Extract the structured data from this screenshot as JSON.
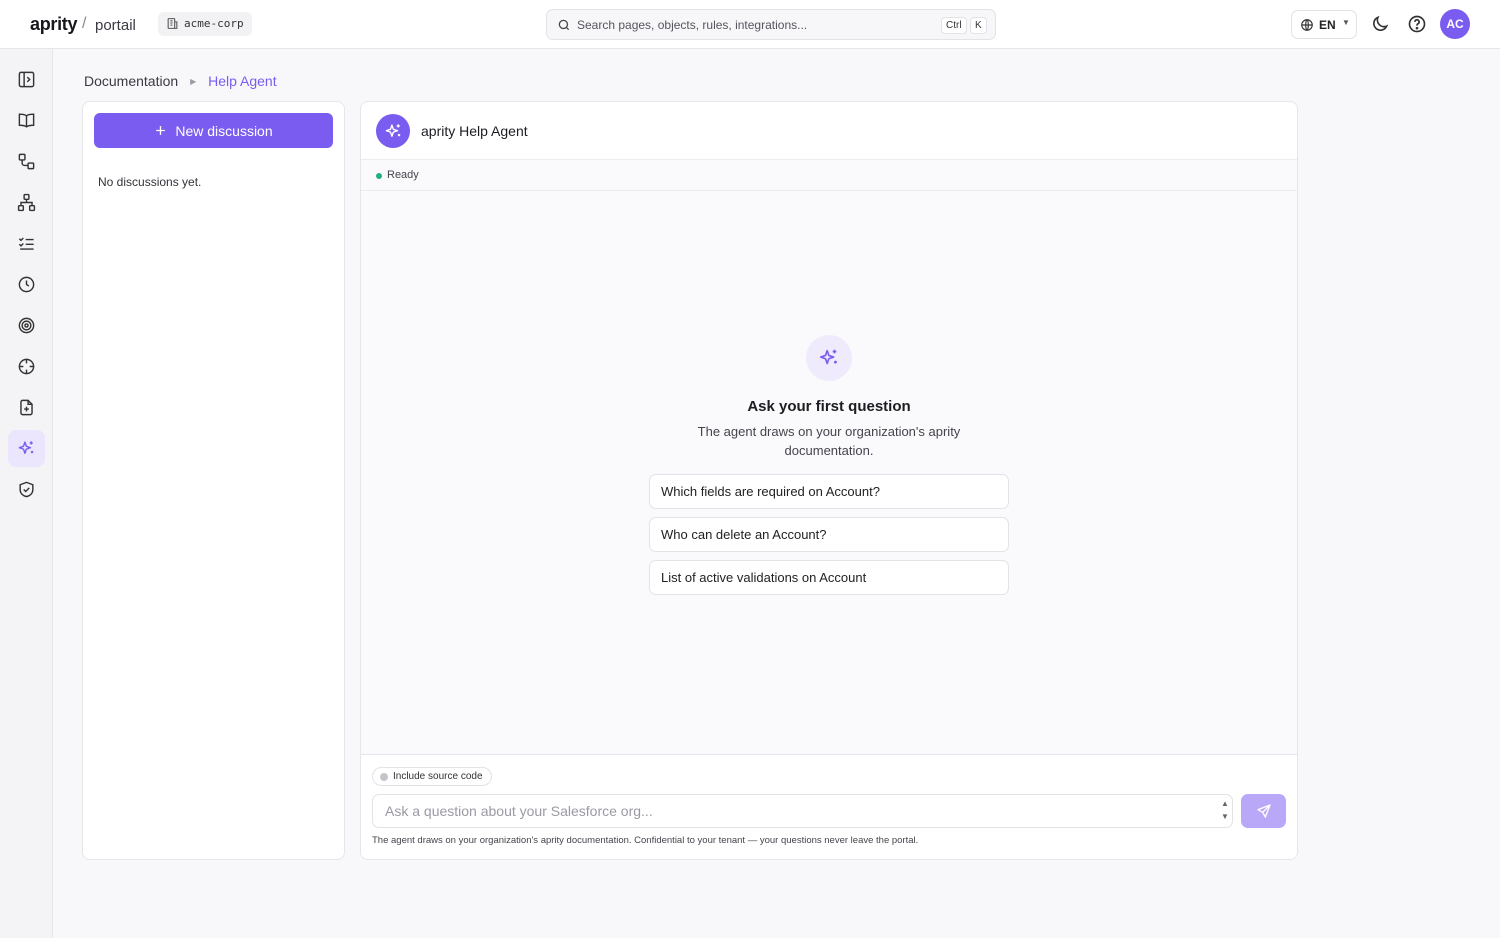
{
  "header": {
    "brand": "aprity",
    "separator": "/",
    "product": "portail",
    "tenant": "acme-corp",
    "search_placeholder": "Search pages, objects, rules, integrations...",
    "shortcut_mod": "Ctrl",
    "shortcut_key": "K",
    "language": "EN",
    "avatar_initials": "AC"
  },
  "rail": {
    "items": [
      {
        "icon": "sidebar-toggle-icon"
      },
      {
        "icon": "book-icon"
      },
      {
        "icon": "flow-icon"
      },
      {
        "icon": "hierarchy-icon"
      },
      {
        "icon": "checklist-icon"
      },
      {
        "icon": "clock-icon"
      },
      {
        "icon": "target-icon"
      },
      {
        "icon": "crosshair-icon"
      },
      {
        "icon": "file-add-icon"
      },
      {
        "icon": "sparkles-icon",
        "active": true
      },
      {
        "icon": "shield-check-icon"
      }
    ]
  },
  "breadcrumb": {
    "parent": "Documentation",
    "current": "Help Agent"
  },
  "discussions": {
    "new_label": "New discussion",
    "empty_text": "No discussions yet."
  },
  "chat": {
    "agent_name": "aprity Help Agent",
    "status": "Ready",
    "empty_title": "Ask your first question",
    "empty_subtitle": "The agent draws on your organization's aprity documentation.",
    "suggestions": [
      "Which fields are required on Account?",
      "Who can delete an Account?",
      "List of active validations on Account"
    ],
    "include_source_label": "Include source code",
    "input_placeholder": "Ask a question about your Salesforce org...",
    "disclaimer": "The agent draws on your organization's aprity documentation. Confidential to your tenant — your questions never leave the portal."
  },
  "colors": {
    "accent": "#7b5cf0",
    "accent_light": "#efebfd",
    "send_disabled": "#b9a8f7",
    "status_ready": "#22b07d"
  }
}
